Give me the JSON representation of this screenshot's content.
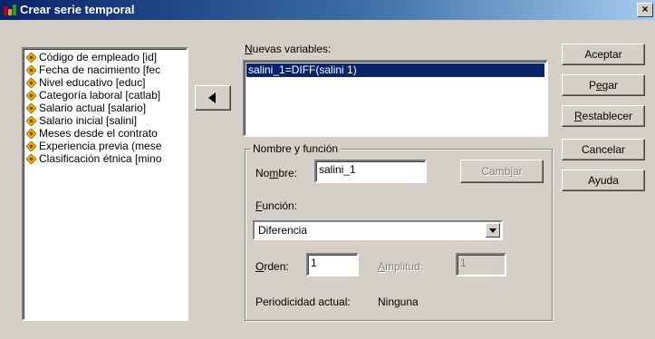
{
  "window": {
    "title": "Crear serie temporal",
    "close_glyph": "×"
  },
  "variables": [
    "Código de empleado [id]",
    "Fecha de nacimiento [fec",
    "Nivel educativo [educ]",
    "Categoría laboral [catlab]",
    "Salario actual [salario]",
    "Salario inicial [salini]",
    "Meses desde el contrato",
    "Experiencia previa (mese",
    "Clasificación étnica [mino"
  ],
  "new_vars": {
    "label_access": "N",
    "label_rest": "uevas variables:",
    "items": [
      "salini_1=DIFF(salini 1)"
    ]
  },
  "group": {
    "title": "Nombre y función",
    "name_label_pre": "No",
    "name_label_access": "m",
    "name_label_post": "bre:",
    "name_value": "salini_1",
    "change_pre": "Camb",
    "change_access": "i",
    "change_post": "ar",
    "function_label_access": "F",
    "function_label_rest": "unción:",
    "function_value": "Diferencia",
    "order_label_access": "O",
    "order_label_rest": "rden:",
    "order_value": "1",
    "span_label_access": "A",
    "span_label_rest": "mplitud:",
    "span_value": "1",
    "periodicity_label": "Periodicidad actual:",
    "periodicity_value": "Ninguna"
  },
  "buttons": {
    "ok": "Aceptar",
    "paste_pre": "P",
    "paste_access": "e",
    "paste_post": "gar",
    "reset_access": "R",
    "reset_rest": "establecer",
    "cancel": "Cancelar",
    "help": "Ayuda"
  },
  "colors": {
    "title_start": "#0a246a",
    "title_end": "#a6caf0",
    "selection": "#0a246a",
    "face": "#d4d0c8"
  }
}
